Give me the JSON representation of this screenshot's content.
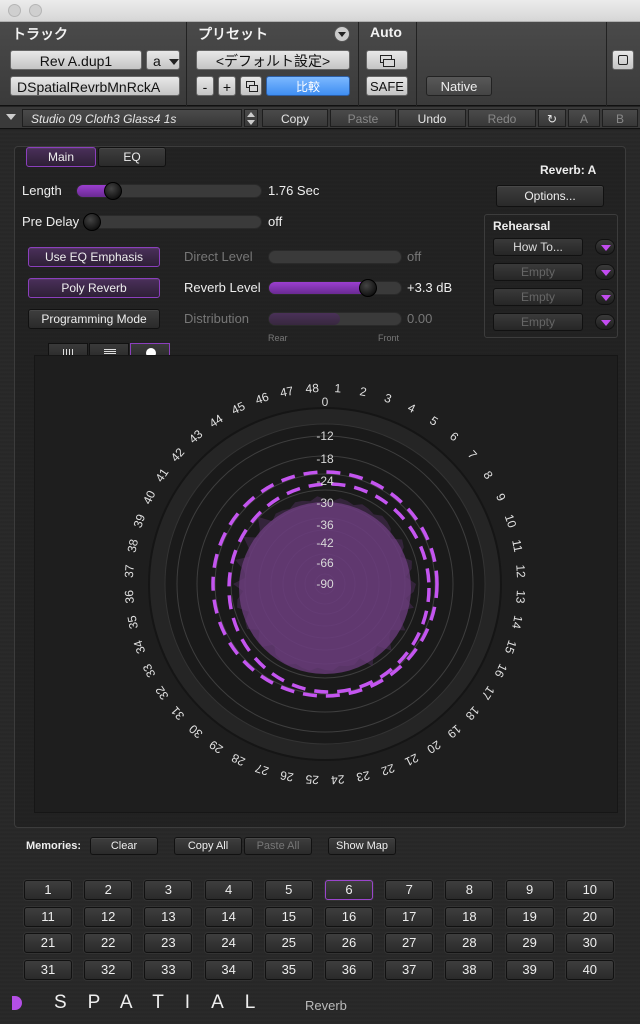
{
  "header": {
    "track_label": "トラック",
    "preset_label": "プリセット",
    "auto_label": "Auto",
    "track_name": "Rev A.dup1",
    "track_channel": "a",
    "plugin_name": "DSpatialRevrbMnRckA",
    "preset_name": "<デフォルト設定>",
    "minus": "-",
    "plus": "+",
    "compare": "比較",
    "safe": "SAFE",
    "native": "Native"
  },
  "toolbar": {
    "preset_path": "Studio 09 Cloth3 Glass4 1s",
    "copy": "Copy",
    "paste": "Paste",
    "undo": "Undo",
    "redo": "Redo",
    "a": "A",
    "b": "B"
  },
  "tabs": {
    "main": "Main",
    "eq": "EQ"
  },
  "reverb_id": "Reverb: A",
  "options": "Options...",
  "params": {
    "length_label": "Length",
    "length_value": "1.76 Sec",
    "length_fraction": 0.17,
    "predelay_label": "Pre Delay",
    "predelay_value": "off",
    "predelay_fraction": 0.0,
    "direct_label": "Direct Level",
    "direct_value": "off",
    "reverb_label": "Reverb Level",
    "reverb_value": "+3.3 dB",
    "reverb_fraction": 0.78,
    "distribution_label": "Distribution",
    "distribution_value": "0.00",
    "distribution_fraction": 0.5,
    "rear": "Rear",
    "front": "Front"
  },
  "buttons": {
    "use_eq": "Use EQ Emphasis",
    "poly": "Poly Reverb",
    "programming": "Programming Mode"
  },
  "rehearsal": {
    "title": "Rehearsal",
    "items": [
      "How To...",
      "Empty",
      "Empty",
      "Empty"
    ]
  },
  "display": {
    "db_labels": [
      "0",
      "-12",
      "-18",
      "-24",
      "-30",
      "-36",
      "-42",
      "-66",
      "-90"
    ],
    "channel_labels": [
      "1",
      "2",
      "3",
      "4",
      "5",
      "6",
      "7",
      "8",
      "9",
      "10",
      "11",
      "12",
      "13",
      "14",
      "15",
      "16",
      "17",
      "18",
      "19",
      "20",
      "21",
      "22",
      "23",
      "24",
      "25",
      "26",
      "27",
      "28",
      "29",
      "30",
      "31",
      "32",
      "33",
      "34",
      "35",
      "36",
      "37",
      "38",
      "39",
      "40",
      "41",
      "42",
      "43",
      "44",
      "45",
      "46",
      "47",
      "48"
    ]
  },
  "memories": {
    "label": "Memories:",
    "clear": "Clear",
    "copy_all": "Copy All",
    "paste_all": "Paste All",
    "show_map": "Show Map",
    "slots": [
      "1",
      "2",
      "3",
      "4",
      "5",
      "6",
      "7",
      "8",
      "9",
      "10",
      "11",
      "12",
      "13",
      "14",
      "15",
      "16",
      "17",
      "18",
      "19",
      "20",
      "21",
      "22",
      "23",
      "24",
      "25",
      "26",
      "27",
      "28",
      "29",
      "30",
      "31",
      "32",
      "33",
      "34",
      "35",
      "36",
      "37",
      "38",
      "39",
      "40"
    ],
    "selected": "6"
  },
  "brand": {
    "name": "SPATIAL",
    "product": "Reverb"
  },
  "colors": {
    "accent": "#b44fe6",
    "panel": "#232323"
  }
}
